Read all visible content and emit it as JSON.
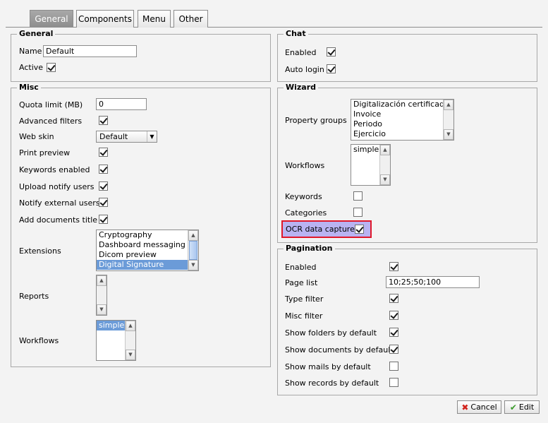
{
  "tabs": [
    {
      "label": "General"
    },
    {
      "label": "Components"
    },
    {
      "label": "Menu"
    },
    {
      "label": "Other"
    }
  ],
  "general": {
    "legend": "General",
    "name_label": "Name",
    "name_value": "Default",
    "active_label": "Active",
    "active_checked": true
  },
  "chat": {
    "legend": "Chat",
    "enabled_label": "Enabled",
    "enabled_checked": true,
    "autologin_label": "Auto login",
    "autologin_checked": true
  },
  "misc": {
    "legend": "Misc",
    "quota_label": "Quota limit (MB)",
    "quota_value": "0",
    "advanced_filters_label": "Advanced filters",
    "web_skin_label": "Web skin",
    "web_skin_value": "Default",
    "print_preview_label": "Print preview",
    "keywords_enabled_label": "Keywords enabled",
    "upload_notify_label": "Upload notify users",
    "notify_external_label": "Notify external users",
    "add_docs_title_label": "Add documents title",
    "extensions_label": "Extensions",
    "extensions": [
      "Cryptography",
      "Dashboard messaging",
      "Dicom preview",
      "Digital Signature"
    ],
    "reports_label": "Reports",
    "workflows_label": "Workflows",
    "workflows": [
      "simple"
    ]
  },
  "wizard": {
    "legend": "Wizard",
    "property_groups_label": "Property groups",
    "property_groups": [
      "Digitalización certificada",
      "Invoice",
      "Periodo",
      "Ejercicio"
    ],
    "workflows_label": "Workflows",
    "workflows": [
      "simple"
    ],
    "keywords_label": "Keywords",
    "categories_label": "Categories",
    "ocr_label": "OCR data capture",
    "ocr_checked": true,
    "highlight_color": "#e0182b"
  },
  "pagination": {
    "legend": "Pagination",
    "enabled_label": "Enabled",
    "page_list_label": "Page list",
    "page_list_value": "10;25;50;100",
    "type_filter_label": "Type filter",
    "misc_filter_label": "Misc filter",
    "show_folders_label": "Show folders by default",
    "show_documents_label": "Show documents by default",
    "show_mails_label": "Show mails by default",
    "show_records_label": "Show records by default"
  },
  "buttons": {
    "cancel": "Cancel",
    "edit": "Edit"
  }
}
